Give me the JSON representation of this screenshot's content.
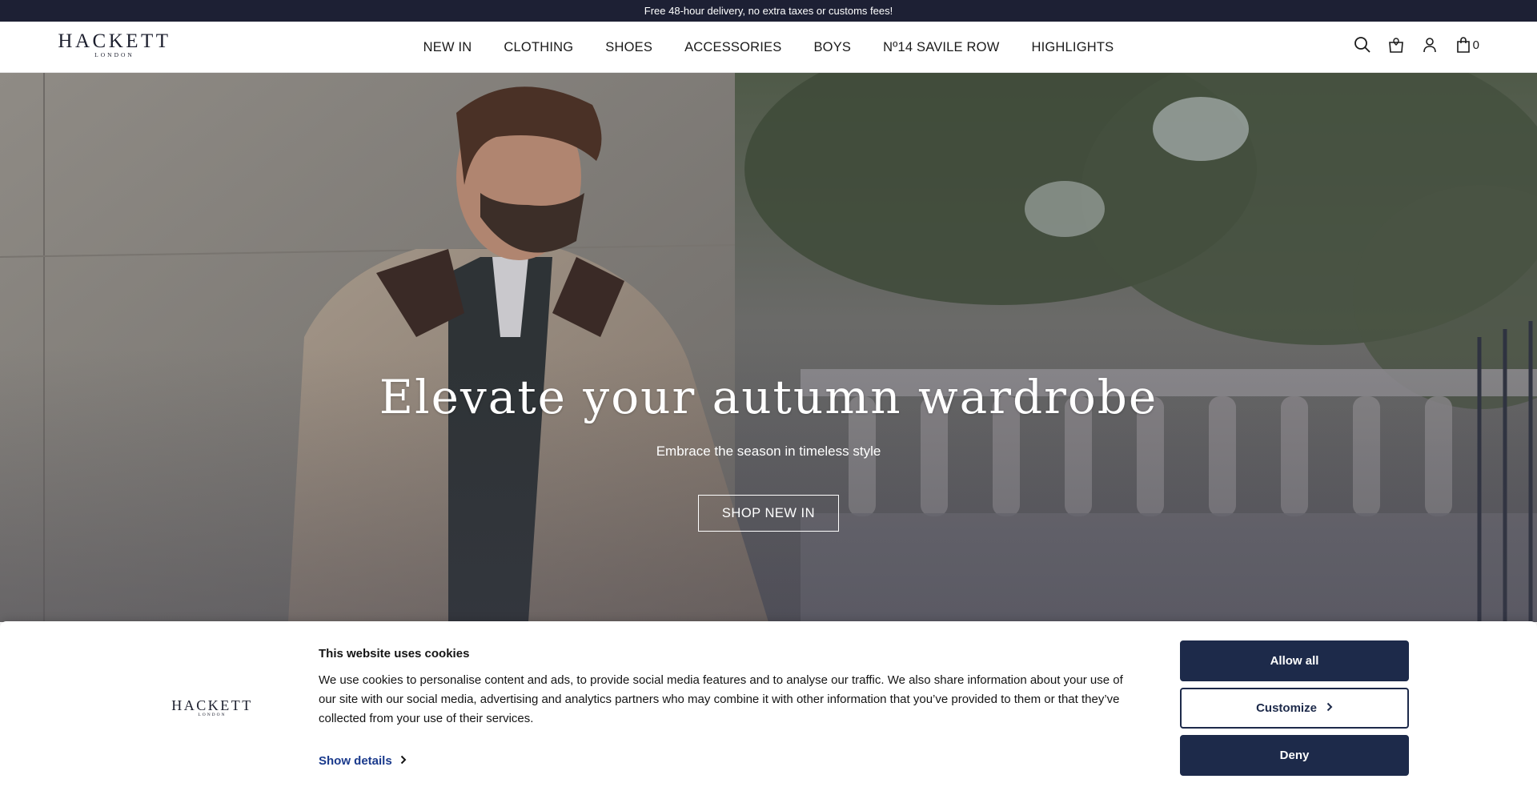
{
  "promo_bar": {
    "text": "Free 48-hour delivery, no extra taxes or customs fees!"
  },
  "header": {
    "logo": {
      "main": "HACKETT",
      "sub": "LONDON"
    },
    "nav": [
      "NEW IN",
      "CLOTHING",
      "SHOES",
      "ACCESSORIES",
      "BOYS",
      "Nº14 SAVILE ROW",
      "HIGHLIGHTS"
    ],
    "icons": [
      "search-icon",
      "store-locator-icon",
      "account-icon",
      "shopping-bag-icon"
    ],
    "cart_count": "0"
  },
  "hero": {
    "title": "Elevate your autumn wardrobe",
    "subtitle": "Embrace the season in timeless style",
    "cta": "SHOP NEW IN"
  },
  "cookie_banner": {
    "logo": {
      "main": "HACKETT",
      "sub": "LONDON"
    },
    "title": "This website uses cookies",
    "text": "We use cookies to personalise content and ads, to provide social media features and to analyse our traffic. We also share information about your use of our site with our social media, advertising and analytics partners who may combine it with other information that you’ve provided to them or that they’ve collected from your use of their services.",
    "show_details": "Show details",
    "buttons": {
      "allow_all": "Allow all",
      "customize": "Customize",
      "deny": "Deny"
    }
  },
  "colors": {
    "navy": "#1d2a4a",
    "promo_bg": "#1d2034",
    "link": "#1a3a8c"
  }
}
